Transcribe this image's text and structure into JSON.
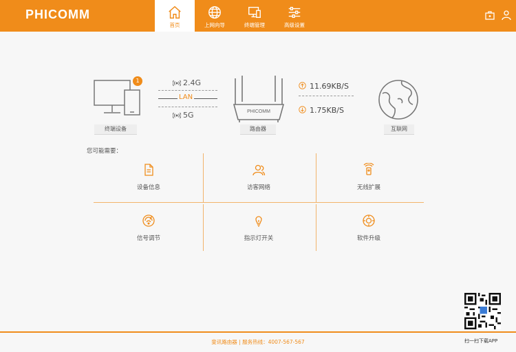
{
  "header": {
    "logo": "PHICOMM",
    "nav": [
      {
        "label": "首页",
        "icon": "home-icon",
        "active": true
      },
      {
        "label": "上网向导",
        "icon": "globe-icon",
        "active": false
      },
      {
        "label": "终端管理",
        "icon": "devices-icon",
        "active": false
      },
      {
        "label": "高级设置",
        "icon": "sliders-icon",
        "active": false
      }
    ],
    "right_icons": [
      "toolbox-icon",
      "user-icon"
    ]
  },
  "status": {
    "terminal_label": "终端设备",
    "terminal_count": "1",
    "band_24": "2.4G",
    "lan": "LAN",
    "band_5": "5G",
    "router_brand": "PHICOMM",
    "router_label": "路由器",
    "upload": "11.69KB/S",
    "download": "1.75KB/S",
    "internet_label": "互联网"
  },
  "quick": {
    "hint": "您可能需要：",
    "items": [
      {
        "label": "设备信息",
        "icon": "document-icon"
      },
      {
        "label": "访客网络",
        "icon": "guest-users-icon"
      },
      {
        "label": "无线扩展",
        "icon": "wireless-extend-icon"
      },
      {
        "label": "信号调节",
        "icon": "signal-adjust-icon"
      },
      {
        "label": "指示灯开关",
        "icon": "lightbulb-icon"
      },
      {
        "label": "软件升级",
        "icon": "upgrade-icon"
      }
    ]
  },
  "footer": {
    "text": "斐讯路由器 | 服务热线：4007-567-567",
    "scan_text": "扫一扫下载APP"
  },
  "colors": {
    "accent": "#f08c1a",
    "divider": "#f2b36a"
  }
}
